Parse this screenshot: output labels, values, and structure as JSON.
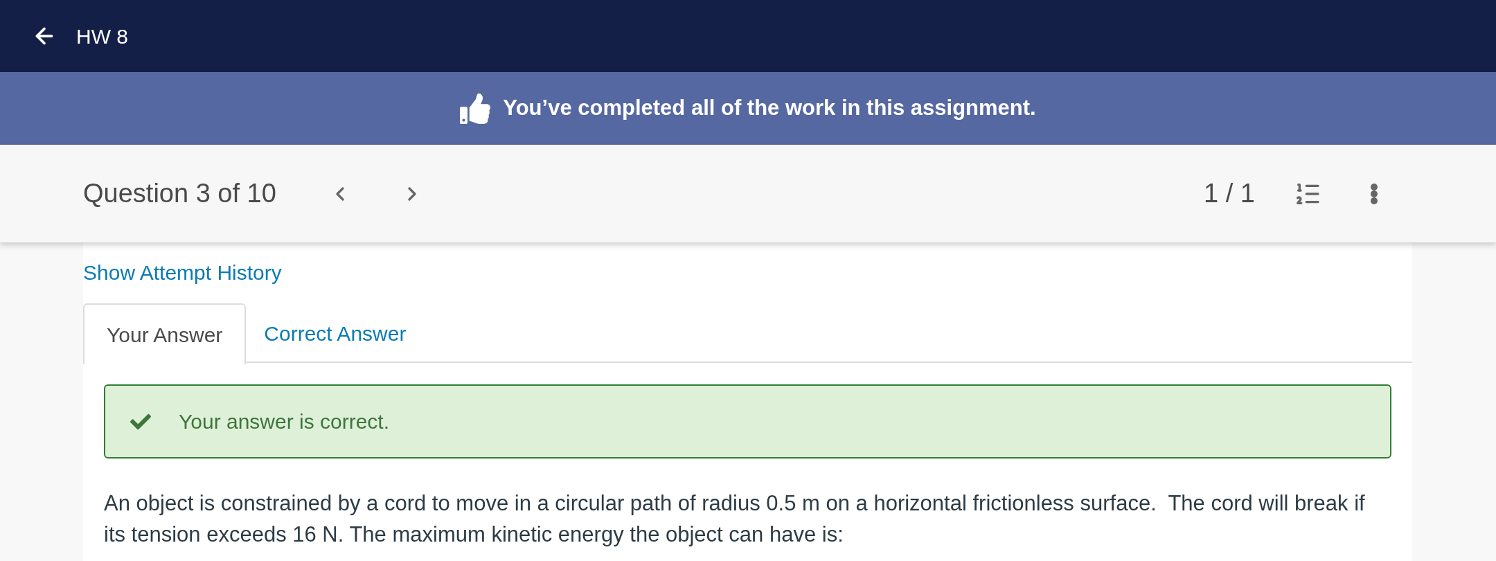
{
  "header": {
    "title": "HW 8"
  },
  "banner": {
    "message": "You’ve completed all of the work in this assignment."
  },
  "question_bar": {
    "label": "Question 3 of 10",
    "score": "1 / 1"
  },
  "attempt_history_link": "Show Attempt History",
  "tabs": [
    {
      "label": "Your Answer",
      "selected": true
    },
    {
      "label": "Correct Answer",
      "selected": false
    }
  ],
  "feedback": {
    "kind": "correct",
    "message": "Your answer is correct."
  },
  "question": {
    "text": "An object is constrained by a cord to move in a circular path of radius 0.5 m on a horizontal frictionless surface.  The cord will break if its tension exceeds 16 N. The maximum kinetic energy the object can have is:"
  }
}
